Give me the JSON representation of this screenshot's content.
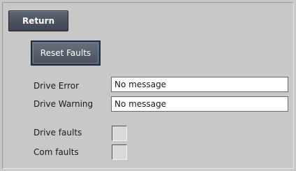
{
  "buttons": {
    "return_label": "Return",
    "reset_faults_label": "Reset Faults"
  },
  "fields": {
    "drive_error": {
      "label": "Drive Error",
      "value": "No message"
    },
    "drive_warning": {
      "label": "Drive Warning",
      "value": "No message"
    }
  },
  "indicators": {
    "drive_faults": {
      "label": "Drive faults"
    },
    "com_faults": {
      "label": "Com faults"
    }
  }
}
